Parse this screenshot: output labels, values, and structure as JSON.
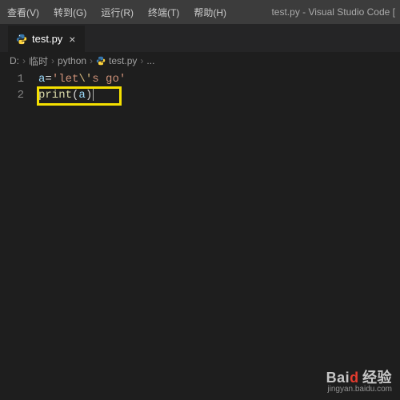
{
  "menubar": {
    "items": [
      "查看(V)",
      "转到(G)",
      "运行(R)",
      "终端(T)",
      "帮助(H)"
    ],
    "title": "test.py - Visual Studio Code ["
  },
  "tab": {
    "filename": "test.py",
    "close": "×"
  },
  "breadcrumb": {
    "drive": "D:",
    "folder": "临时",
    "subfolder": "python",
    "file": "test.py",
    "more": "...",
    "sep": "›"
  },
  "code": {
    "line1": {
      "num": "1",
      "var": "a",
      "op": "=",
      "q1": "'",
      "s1": "let",
      "esc": "\\'",
      "s2": "s go",
      "q2": "'"
    },
    "line2": {
      "num": "2",
      "fn": "print",
      "lp": "(",
      "arg": "a",
      "rp": ")"
    }
  },
  "watermark": {
    "brand_a": "Bai",
    "brand_b": "d",
    "brand_c": "经验",
    "url": "jingyan.baidu.com"
  }
}
